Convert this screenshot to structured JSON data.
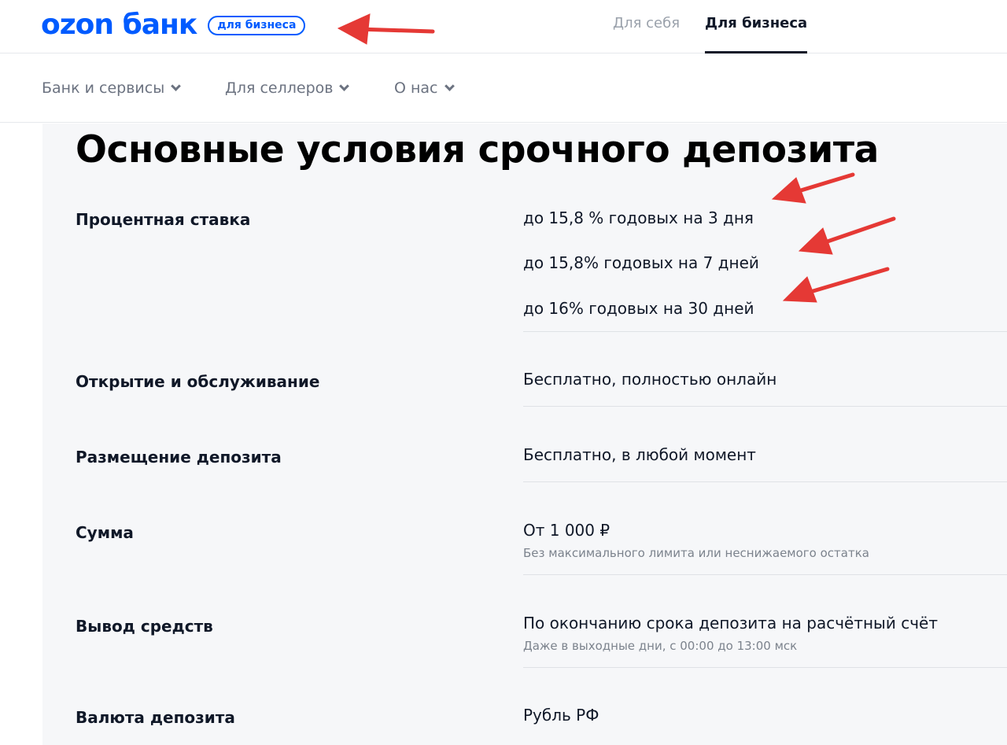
{
  "header": {
    "logo_text": "ozon банк",
    "badge": "для бизнеса",
    "tabs": [
      {
        "label": "Для себя",
        "active": false
      },
      {
        "label": "Для бизнеса",
        "active": true
      }
    ]
  },
  "subnav": {
    "items": [
      {
        "label": "Банк и сервисы"
      },
      {
        "label": "Для селлеров"
      },
      {
        "label": "О нас"
      }
    ]
  },
  "main": {
    "title": "Основные условия срочного депозита",
    "rows": [
      {
        "label": "Процентная ставка",
        "values": [
          "до 15,8 % годовых на 3 дня",
          "до 15,8% годовых на 7 дней",
          "до 16% годовых на 30 дней"
        ]
      },
      {
        "label": "Открытие и обслуживание",
        "value": "Бесплатно, полностью онлайн"
      },
      {
        "label": "Размещение депозита",
        "value": "Бесплатно, в любой момент"
      },
      {
        "label": "Сумма",
        "value": "От 1 000 ₽",
        "note": "Без максимального лимита или неснижаемого остатка"
      },
      {
        "label": "Вывод средств",
        "value": "По окончанию срока депозита на расчётный счёт",
        "note": "Даже в выходные дни, с 00:00 до 13:00 мск"
      },
      {
        "label": "Валюта депозита",
        "value": "Рубль РФ"
      }
    ]
  },
  "colors": {
    "brand": "#005bff",
    "annotation_arrow": "#e53935",
    "content_bg": "#f6f7f9"
  }
}
